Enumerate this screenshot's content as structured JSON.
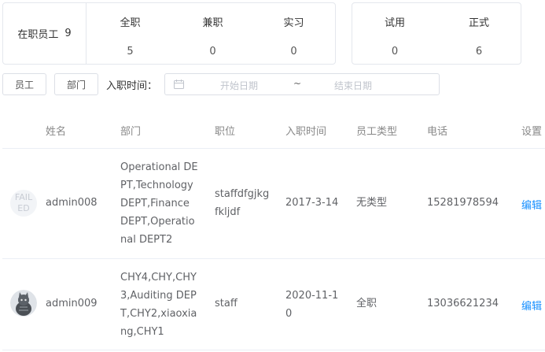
{
  "summary": {
    "total_label": "在职员工",
    "total_value": "9",
    "types": [
      {
        "label": "全职",
        "value": "5"
      },
      {
        "label": "兼职",
        "value": "0"
      },
      {
        "label": "实习",
        "value": "0"
      }
    ],
    "status": [
      {
        "label": "试用",
        "value": "0"
      },
      {
        "label": "正式",
        "value": "6"
      }
    ]
  },
  "filters": {
    "employee_btn": "员工",
    "dept_btn": "部门",
    "hire_time_label": "入职时间：",
    "start_placeholder": "开始日期",
    "range_sep": "~",
    "end_placeholder": "结束日期"
  },
  "table": {
    "headers": [
      "姓名",
      "部门",
      "职位",
      "入职时间",
      "员工类型",
      "电话",
      "设置"
    ],
    "rows": [
      {
        "avatar_text": "FAIL ED",
        "name": "admin008",
        "dept": "Operational DEPT,Technology DEPT,Finance DEPT,Operational DEPT2",
        "position": "staffdfgjkgfkljdf",
        "hire_date": "2017-3-14",
        "type": "无类型",
        "phone": "15281978594",
        "action": "编辑"
      },
      {
        "avatar_text": "",
        "name": "admin009",
        "dept": "CHY4,CHY,CHY3,Auditing DEPT,CHY2,xiaoxiang,CHY1",
        "position": "staff",
        "hire_date": "2020-11-10",
        "type": "全职",
        "phone": "13036621234",
        "action": "编辑"
      }
    ]
  },
  "colors": {
    "link": "#1890ff",
    "border": "#e4e7ed"
  }
}
